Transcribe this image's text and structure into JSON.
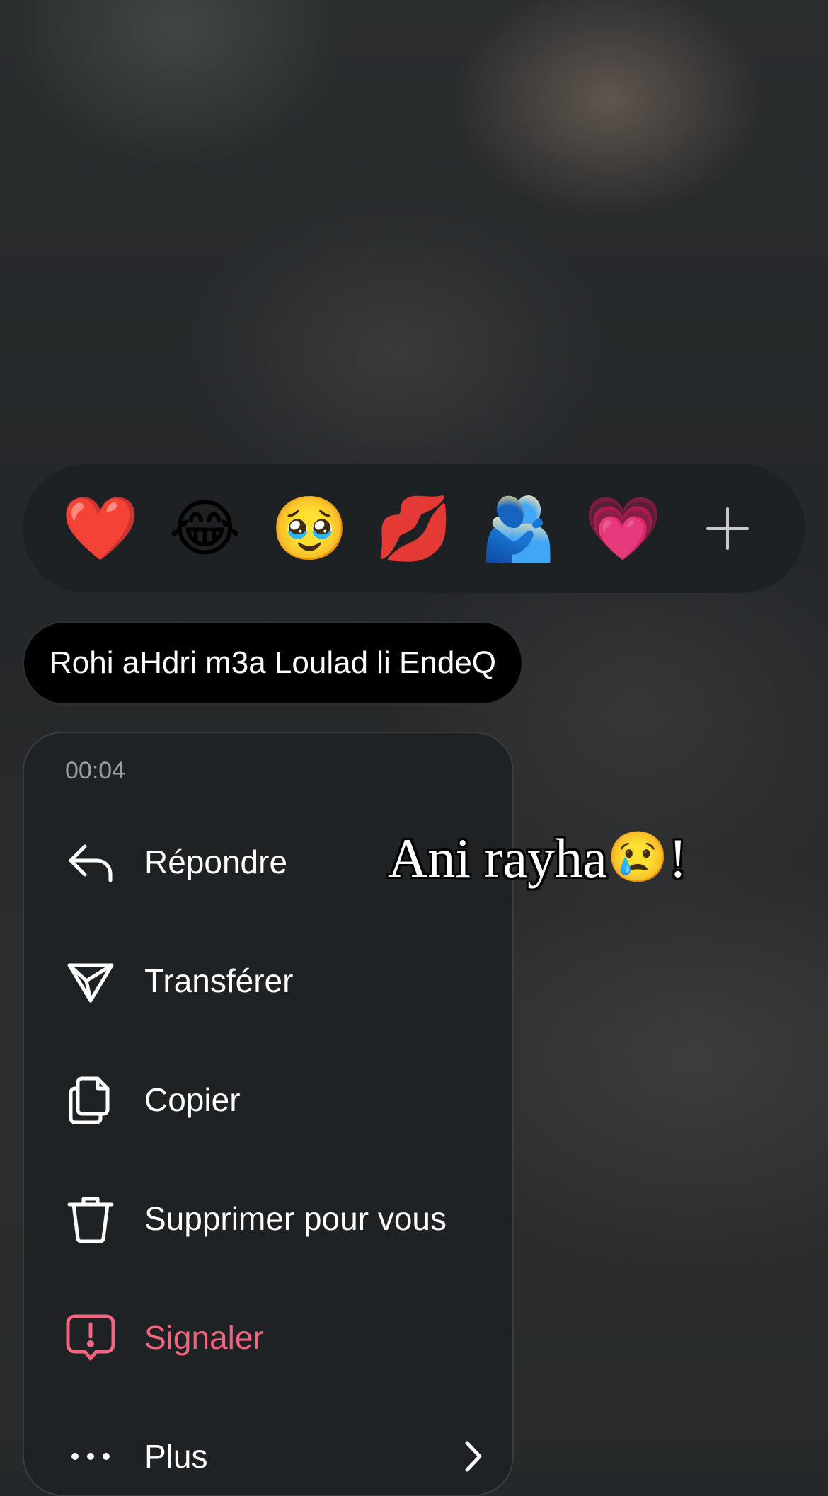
{
  "reactions": {
    "emojis": [
      {
        "glyph": "❤️",
        "name": "red-heart"
      },
      {
        "glyph": "😂",
        "name": "tears-of-joy"
      },
      {
        "glyph": "🥹",
        "name": "holding-back-tears"
      },
      {
        "glyph": "💋",
        "name": "kiss-mark"
      },
      {
        "glyph": "🫂",
        "name": "people-hugging"
      },
      {
        "glyph": "💗",
        "name": "growing-heart"
      }
    ],
    "more_icon": "plus-icon"
  },
  "message": {
    "text": "Rohi aHdri m3a Loulad li EndeQ"
  },
  "overlay": {
    "text": "Ani rayha",
    "emoji": "😢",
    "suffix": "!"
  },
  "menu": {
    "timestamp": "00:04",
    "items": [
      {
        "label": "Répondre",
        "icon": "reply-icon"
      },
      {
        "label": "Transférer",
        "icon": "send-icon"
      },
      {
        "label": "Copier",
        "icon": "copy-icon"
      },
      {
        "label": "Supprimer pour vous",
        "icon": "trash-icon"
      },
      {
        "label": "Signaler",
        "icon": "report-icon"
      },
      {
        "label": "Plus",
        "icon": "more-icon"
      }
    ]
  },
  "colors": {
    "danger": "#f3647e",
    "menu_bg": "#1e2123",
    "bubble_bg": "#000000"
  }
}
